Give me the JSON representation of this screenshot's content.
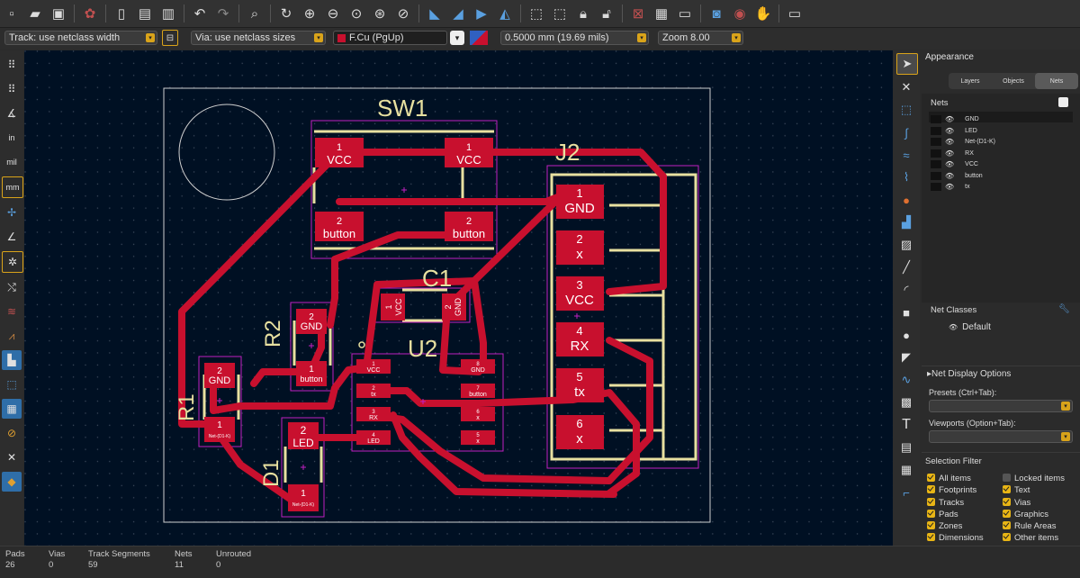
{
  "toolbar": {
    "icons": [
      "new-board-icon",
      "open-icon",
      "save-icon",
      "board-setup-icon",
      "page-settings-icon",
      "print-icon",
      "plot-icon",
      "undo-icon",
      "redo-icon",
      "find-icon",
      "redraw-icon",
      "zoom-in-icon",
      "zoom-out-icon",
      "zoom-fit-icon",
      "zoom-objects-icon",
      "zoom-selection-icon",
      "flip-board-icon",
      "rotate-ccw-icon",
      "rotate-cw-icon",
      "mirror-icon",
      "group-icon",
      "ungroup-icon",
      "lock-icon",
      "unlock-icon",
      "netlist-icon",
      "footprint-editor-icon",
      "footprint-browser-icon",
      "update-pcb-icon",
      "drc-icon",
      "scripting-icon",
      "terminal-icon"
    ]
  },
  "options": {
    "track_width": "Track: use netclass width",
    "via_size": "Via: use netclass sizes",
    "layer": "F.Cu (PgUp)",
    "grid": "0.5000 mm (19.69 mils)",
    "zoom": "Zoom 8.00"
  },
  "pcb": {
    "refs": {
      "sw1": "SW1",
      "j2": "J2",
      "c1": "C1",
      "u2": "U2",
      "r1": "R1",
      "r2": "R2",
      "d1": "D1"
    },
    "pads": {
      "sw_vcc": "VCC",
      "sw_button": "button",
      "num1": "1",
      "num2": "2",
      "num3": "3",
      "num4": "4",
      "num5": "5",
      "num6": "6",
      "num7": "7",
      "num8": "8",
      "gnd": "GND",
      "x": "x",
      "vcc": "VCC",
      "rx": "RX",
      "tx": "tx",
      "button": "button",
      "led": "LED",
      "net_d1k": "Net-(D1-K)"
    }
  },
  "panel": {
    "title": "Appearance",
    "tabs": [
      "Layers",
      "Objects",
      "Nets"
    ],
    "nets_header": "Nets",
    "nets": [
      "GND",
      "LED",
      "Net-(D1-K)",
      "RX",
      "VCC",
      "button",
      "tx"
    ],
    "net_classes_header": "Net Classes",
    "net_class_default": "Default",
    "net_display_options": "Net Display Options",
    "presets_label": "Presets (Ctrl+Tab):",
    "viewports_label": "Viewports (Option+Tab):",
    "selection_filter_header": "Selection Filter",
    "filters_left": [
      {
        "label": "All items",
        "checked": true
      },
      {
        "label": "Footprints",
        "checked": true
      },
      {
        "label": "Tracks",
        "checked": true
      },
      {
        "label": "Pads",
        "checked": true
      },
      {
        "label": "Zones",
        "checked": true
      },
      {
        "label": "Dimensions",
        "checked": true
      }
    ],
    "filters_right": [
      {
        "label": "Locked items",
        "checked": false
      },
      {
        "label": "Text",
        "checked": true
      },
      {
        "label": "Vias",
        "checked": true
      },
      {
        "label": "Graphics",
        "checked": true
      },
      {
        "label": "Rule Areas",
        "checked": true
      },
      {
        "label": "Other items",
        "checked": true
      }
    ]
  },
  "status": {
    "pads_label": "Pads",
    "pads_value": "26",
    "vias_label": "Vias",
    "vias_value": "0",
    "segments_label": "Track Segments",
    "segments_value": "59",
    "nets_label": "Nets",
    "nets_value": "11",
    "unrouted_label": "Unrouted",
    "unrouted_value": "0"
  },
  "colors": {
    "board_bg": "#001023",
    "copper": "#c8102e",
    "silk": "#e8e0a0",
    "courtyard": "#c020c0",
    "accent": "#e8b515"
  }
}
